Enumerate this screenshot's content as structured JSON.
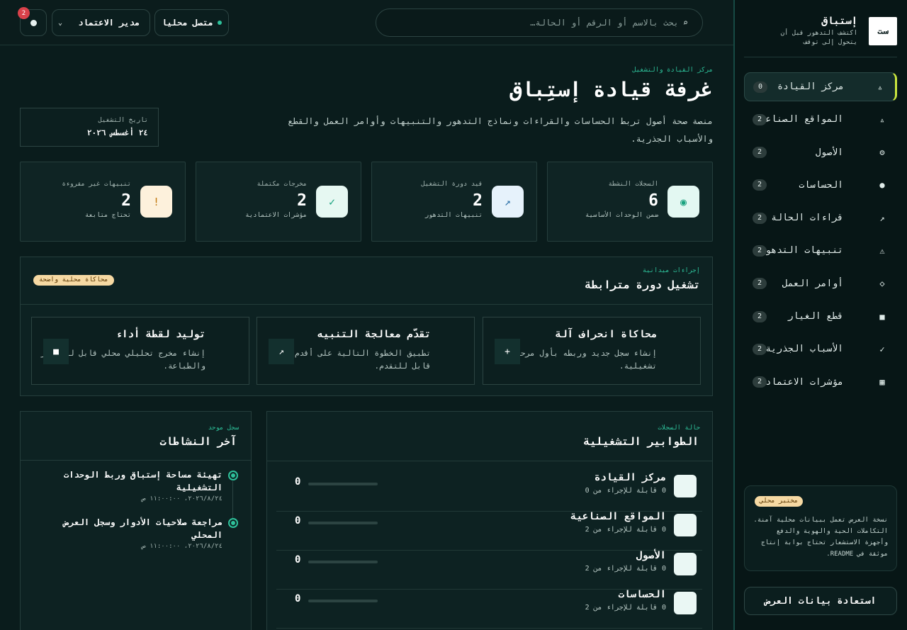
{
  "sidebar": {
    "brand_logo": "ست",
    "brand_name": "إستباق",
    "brand_sub": "اكتشف التدهور قبل أن يتحول إلى توقف",
    "items": [
      {
        "label": "مركز القيادة",
        "icon": "▵",
        "badge": "0",
        "active": true
      },
      {
        "label": "المواقع الصناعية",
        "icon": "▵",
        "badge": "2"
      },
      {
        "label": "الأصول",
        "icon": "⚙",
        "badge": "2"
      },
      {
        "label": "الحساسات",
        "icon": "●",
        "badge": "2"
      },
      {
        "label": "قراءات الحالة",
        "icon": "↗",
        "badge": "2"
      },
      {
        "label": "تنبيهات التدهور",
        "icon": "⚠",
        "badge": "2"
      },
      {
        "label": "أوامر العمل",
        "icon": "◇",
        "badge": "2"
      },
      {
        "label": "قطع الغيار",
        "icon": "■",
        "badge": "2"
      },
      {
        "label": "الأسباب الجذرية",
        "icon": "✓",
        "badge": "2"
      },
      {
        "label": "مؤشرات الاعتمادية",
        "icon": "▦",
        "badge": "2"
      }
    ],
    "lab_badge": "مختبر محلي",
    "lab_text": "نسخة العرض تعمل ببيانات محلية آمنة. التكاملات الحية والهوية والدفع وأجهزة الاستشعار تحتاج بوابة إنتاج موثقة في README.",
    "restore_label": "استعادة بيانات العرض"
  },
  "topbar": {
    "search_placeholder": "بحث بالاسم أو الرقم أو الحالة…",
    "connection_label": "متصل محليا",
    "role_label": "مدير الاعتماد",
    "notif_count": "2"
  },
  "hero": {
    "eyebrow": "مركز القيادة والتشغيل",
    "title": "غرفة قيادة إستِباق",
    "description": "منصة صحة أصول تربط الحساسات والقراءات ونماذج التدهور والتنبيهات وأوامر العمل والقطع والأسباب الجذرية.",
    "date_label": "تاريخ التشغيل",
    "date_value": "٢٤ أغسطس ٢٠٢٦"
  },
  "stats": [
    {
      "label": "السجلات النشطة",
      "value": "6",
      "sub": "ضمن الوحدات الأساسية",
      "icon": "◉",
      "bg": "#e3f8f2",
      "fg": "#1aa37f"
    },
    {
      "label": "قيد دورة التشغيل",
      "value": "2",
      "sub": "تنبيهات التدهور",
      "icon": "↗",
      "bg": "#e6f2fb",
      "fg": "#2a6fa6"
    },
    {
      "label": "مخرجات مكتملة",
      "value": "2",
      "sub": "مؤشرات الاعتمادية",
      "icon": "✓",
      "bg": "#e6f8f2",
      "fg": "#1aa37f"
    },
    {
      "label": "تنبيهات غير مقروءة",
      "value": "2",
      "sub": "تحتاج متابعة",
      "icon": "!",
      "bg": "#fdf1dc",
      "fg": "#c27a12"
    }
  ],
  "ops": {
    "eyebrow": "إجراءات ميدانية",
    "title": "تشغيل دورة مترابطة",
    "tag": "محاكاة محلية واضحة",
    "actions": [
      {
        "title": "محاكاة انحراف آلة",
        "desc": "إنشاء سجل جديد وربطه بأول مرحلة تشغيلية.",
        "icon": "+"
      },
      {
        "title": "تقدّم معالجة التنبيه",
        "desc": "تطبيق الخطوة التالية على أقدم سجل قابل للتقدم.",
        "icon": "↗"
      },
      {
        "title": "توليد لقطة أداء",
        "desc": "إنشاء مخرج تحليلي محلي قابل للتصدير والطباعة.",
        "icon": "■"
      }
    ]
  },
  "queues": {
    "eyebrow": "حالة السجلات",
    "title": "الطوابير التشغيلية",
    "rows": [
      {
        "name": "مركز القيادة",
        "sub": "0 قابلة للإجراء من 0",
        "value": "0",
        "progress": 0
      },
      {
        "name": "المواقع الصناعية",
        "sub": "0 قابلة للإجراء من 2",
        "value": "0",
        "progress": 0
      },
      {
        "name": "الأصول",
        "sub": "0 قابلة للإجراء من 2",
        "value": "0",
        "progress": 0
      },
      {
        "name": "الحساسات",
        "sub": "0 قابلة للإجراء من 2",
        "value": "0",
        "progress": 0
      }
    ]
  },
  "activity": {
    "eyebrow": "سجل موحد",
    "title": "آخر النشاطات",
    "items": [
      {
        "text": "تهيئة مساحة إستباق وربط الوحدات التشغيلية",
        "time": "٢٠٢٦/٨/٢٤، ١١:٠٠:٠٠ ص"
      },
      {
        "text": "مراجعة صلاحيات الأدوار وسجل العرض المحلي",
        "time": "٢٠٢٦/٨/٢٤، ١١:٠٠:٠٠ ص"
      }
    ]
  }
}
